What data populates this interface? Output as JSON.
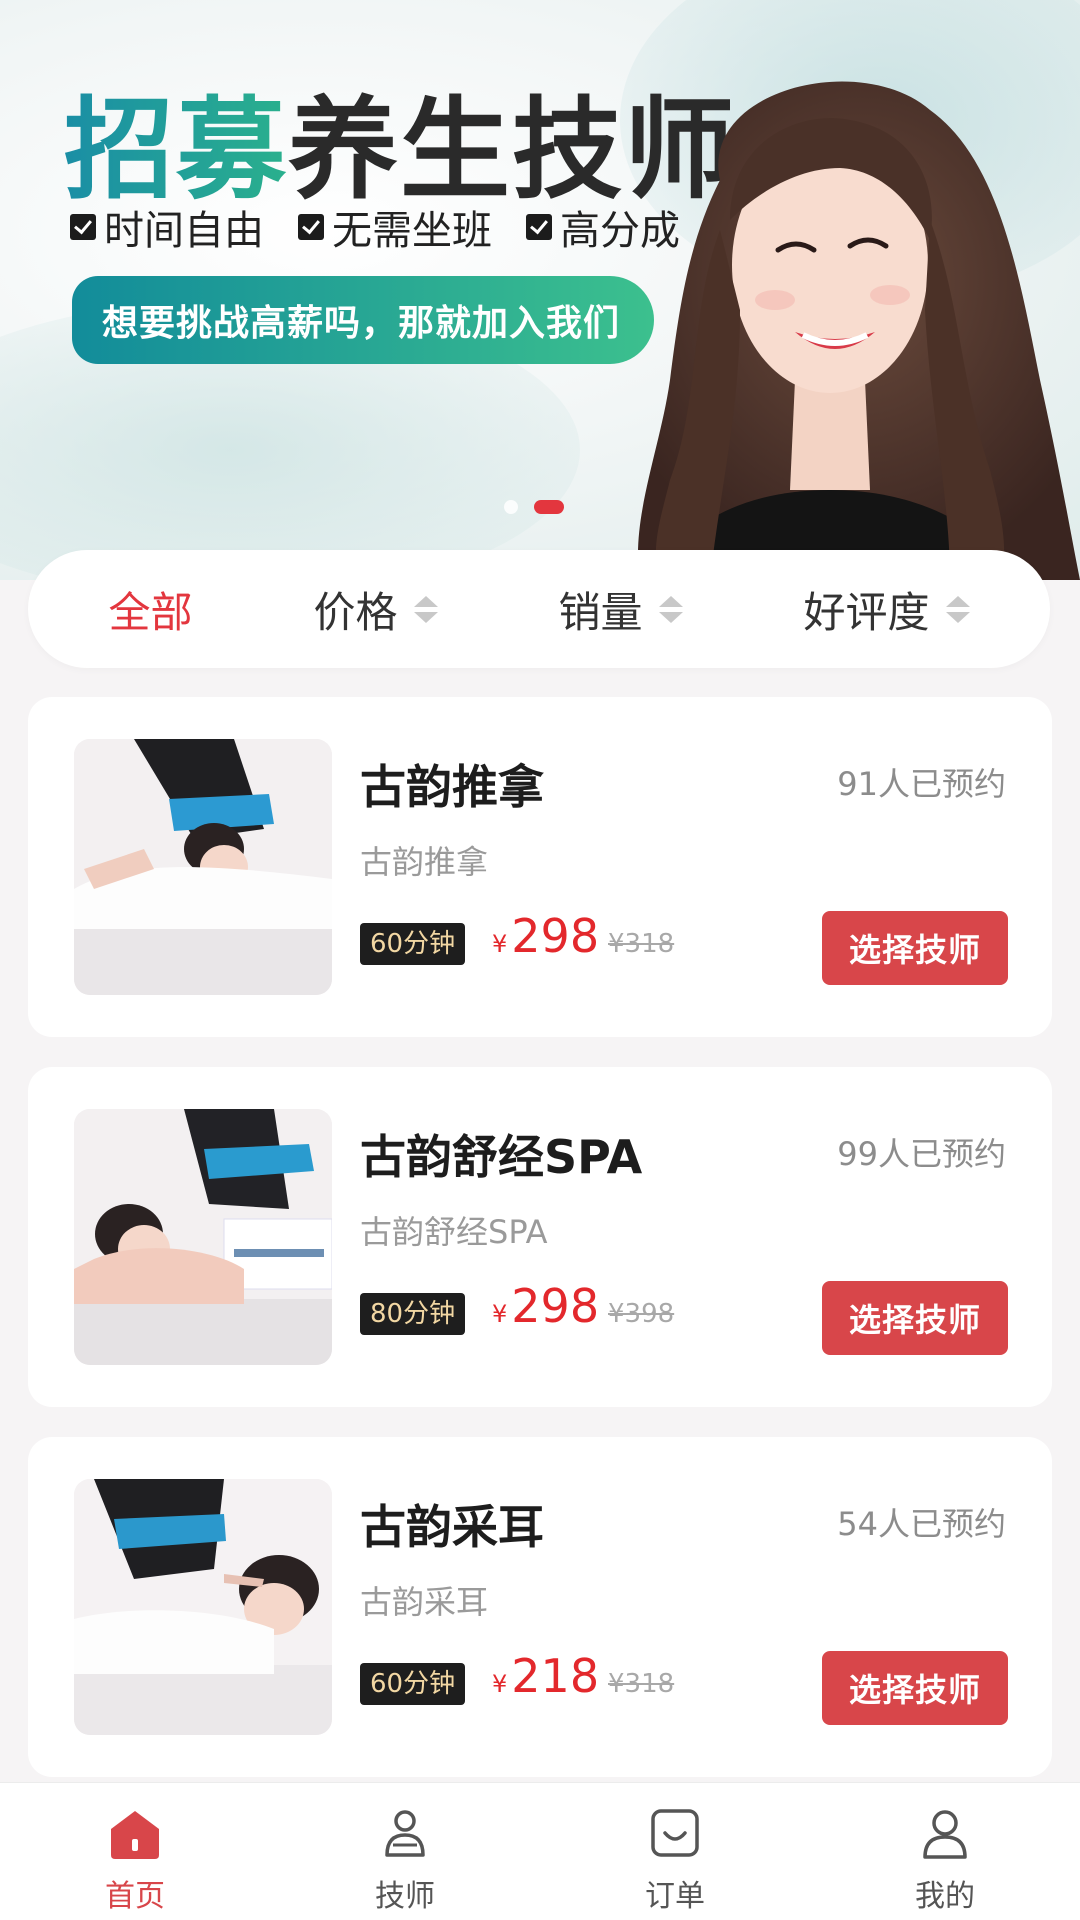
{
  "banner": {
    "headline_accent": "招募",
    "headline_main": "养生技师",
    "features": [
      "时间自由",
      "无需坐班",
      "高分成"
    ],
    "cta": "想要挑战高薪吗，那就加入我们",
    "active_slide": 2,
    "slide_count": 2
  },
  "filters": [
    {
      "label": "全部",
      "active": true
    },
    {
      "label": "价格",
      "active": false
    },
    {
      "label": "销量",
      "active": false
    },
    {
      "label": "好评度",
      "active": false
    }
  ],
  "services": [
    {
      "title": "古韵推拿",
      "subtitle": "古韵推拿",
      "booked": "91人已预约",
      "duration": "60分钟",
      "currency": "¥",
      "price": "298",
      "original_price": "¥318",
      "button": "选择技师"
    },
    {
      "title": "古韵舒经SPA",
      "subtitle": "古韵舒经SPA",
      "booked": "99人已预约",
      "duration": "80分钟",
      "currency": "¥",
      "price": "298",
      "original_price": "¥398",
      "button": "选择技师"
    },
    {
      "title": "古韵采耳",
      "subtitle": "古韵采耳",
      "booked": "54人已预约",
      "duration": "60分钟",
      "currency": "¥",
      "price": "218",
      "original_price": "¥318",
      "button": "选择技师"
    }
  ],
  "tabbar": [
    {
      "label": "首页",
      "icon": "home-icon",
      "active": true
    },
    {
      "label": "技师",
      "icon": "technician-icon",
      "active": false
    },
    {
      "label": "订单",
      "icon": "order-icon",
      "active": false
    },
    {
      "label": "我的",
      "icon": "profile-icon",
      "active": false
    }
  ],
  "colors": {
    "accent": "#e3363e",
    "button": "#d8464a",
    "price": "#e3282c",
    "teal_start": "#128c9a",
    "teal_end": "#3cc08e"
  }
}
